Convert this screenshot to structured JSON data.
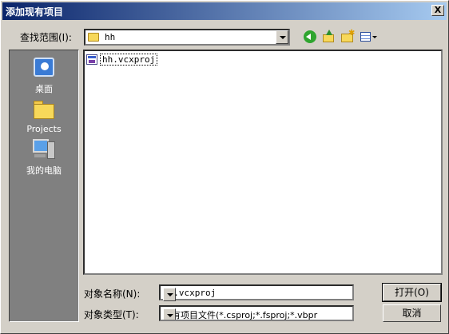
{
  "window": {
    "title": "添加现有项目",
    "close_label": "X"
  },
  "lookin": {
    "label": "查找范围(I):",
    "value": "hh"
  },
  "toolbar": {
    "back_icon": "back-icon",
    "up_icon": "up-folder-icon",
    "new_folder_icon": "new-folder-icon",
    "views_icon": "views-menu-icon"
  },
  "places": [
    {
      "label": "桌面",
      "icon": "desktop-icon"
    },
    {
      "label": "Projects",
      "icon": "folder-icon"
    },
    {
      "label": "我的电脑",
      "icon": "my-computer-icon"
    }
  ],
  "files": [
    {
      "name": "hh.vcxproj",
      "icon": "vcxproj-file-icon",
      "selected": true
    }
  ],
  "filename": {
    "label": "对象名称(N):",
    "value": "hh.vcxproj"
  },
  "filetype": {
    "label": "对象类型(T):",
    "value": "所有项目文件(*.csproj;*.fsproj;*.vbpr"
  },
  "buttons": {
    "open": "打开(O)",
    "cancel": "取消"
  }
}
